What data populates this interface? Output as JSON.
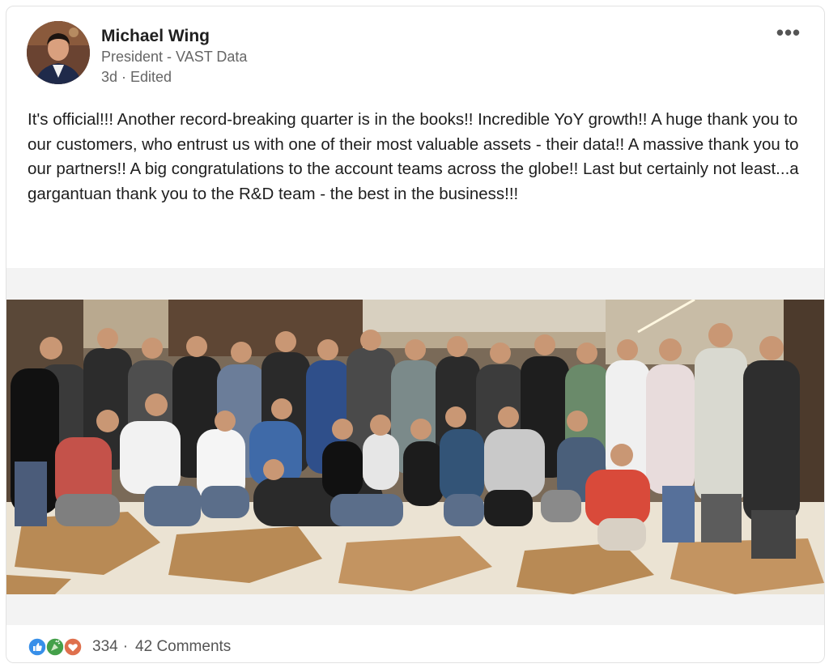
{
  "post": {
    "author": {
      "name": "Michael Wing",
      "title": "President - VAST Data",
      "meta": "3d · Edited"
    },
    "more_label": "•••",
    "text": "It's official!!!  Another record-breaking quarter is in the books!!  Incredible YoY growth!!  A huge thank you to our customers, who entrust us with one of their most valuable assets - their data!!  A massive thank you to our partners!!  A big congratulations to the account teams across the globe!!  Last but certainly not least...a gargantuan thank you to the R&D team - the best in the business!!!",
    "social": {
      "reaction_icons": [
        "like-icon",
        "celebrate-icon",
        "love-icon"
      ],
      "reaction_count": "334",
      "separator": "·",
      "comments_label": "42 Comments"
    }
  },
  "colors": {
    "like": "#378fe9",
    "celebrate": "#44a04a",
    "love": "#df704d",
    "text": "#1e1e1e",
    "muted": "#666666"
  }
}
